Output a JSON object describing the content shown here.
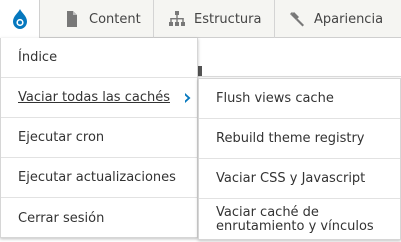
{
  "toolbar": {
    "logo_icon": "drupal-drop-icon",
    "items": [
      {
        "label": "Content",
        "icon": "file-icon"
      },
      {
        "label": "Estructura",
        "icon": "sitemap-icon"
      },
      {
        "label": "Apariencia",
        "icon": "paintbrush-icon"
      }
    ],
    "accent_color": "#0678be"
  },
  "menu": {
    "items": [
      {
        "label": "Índice"
      },
      {
        "label": "Vaciar todas las cachés",
        "expanded": true
      },
      {
        "label": "Ejecutar cron"
      },
      {
        "label": "Ejecutar actualizaciones"
      },
      {
        "label": "Cerrar sesión"
      }
    ],
    "submenu": [
      {
        "label": "Flush views cache"
      },
      {
        "label": "Rebuild theme registry"
      },
      {
        "label": "Vaciar CSS y Javascript"
      },
      {
        "label_line1": "Vaciar caché de",
        "label_line2": "enrutamiento y vínculos"
      }
    ]
  }
}
